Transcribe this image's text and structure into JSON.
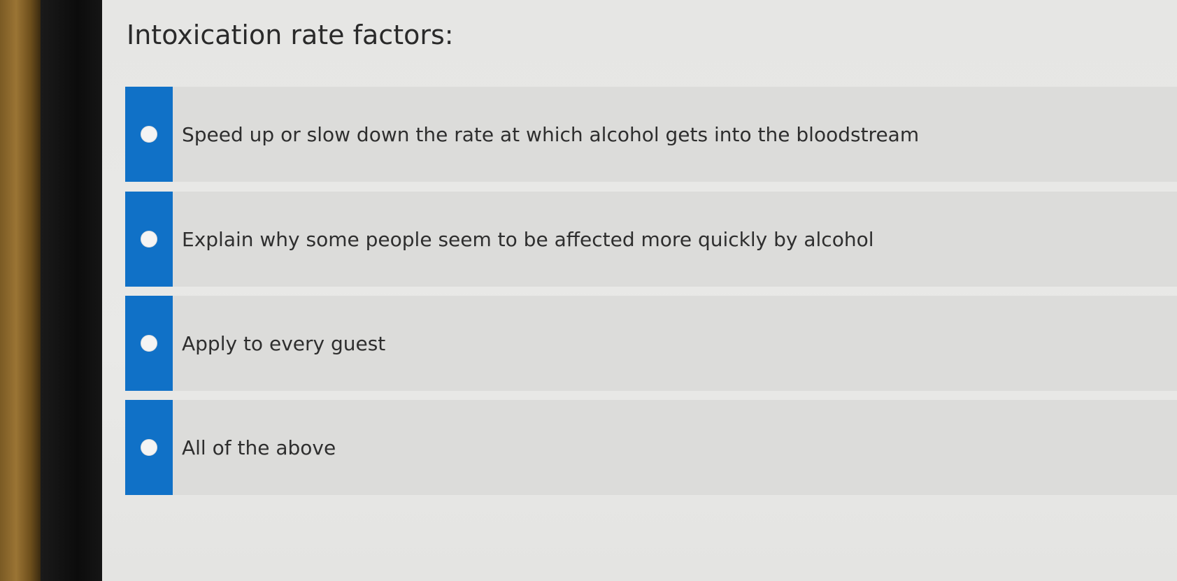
{
  "question": {
    "text": "Intoxication rate factors:"
  },
  "options": [
    {
      "label": "Speed up or slow down the rate at which alcohol gets into the bloodstream"
    },
    {
      "label": "Explain why some people seem to be affected more quickly by alcohol"
    },
    {
      "label": "Apply to every guest"
    },
    {
      "label": "All of the above"
    }
  ],
  "colors": {
    "accent": "#1071c7",
    "option_background": "#dcdcda",
    "page_background": "#e7e7e5"
  }
}
